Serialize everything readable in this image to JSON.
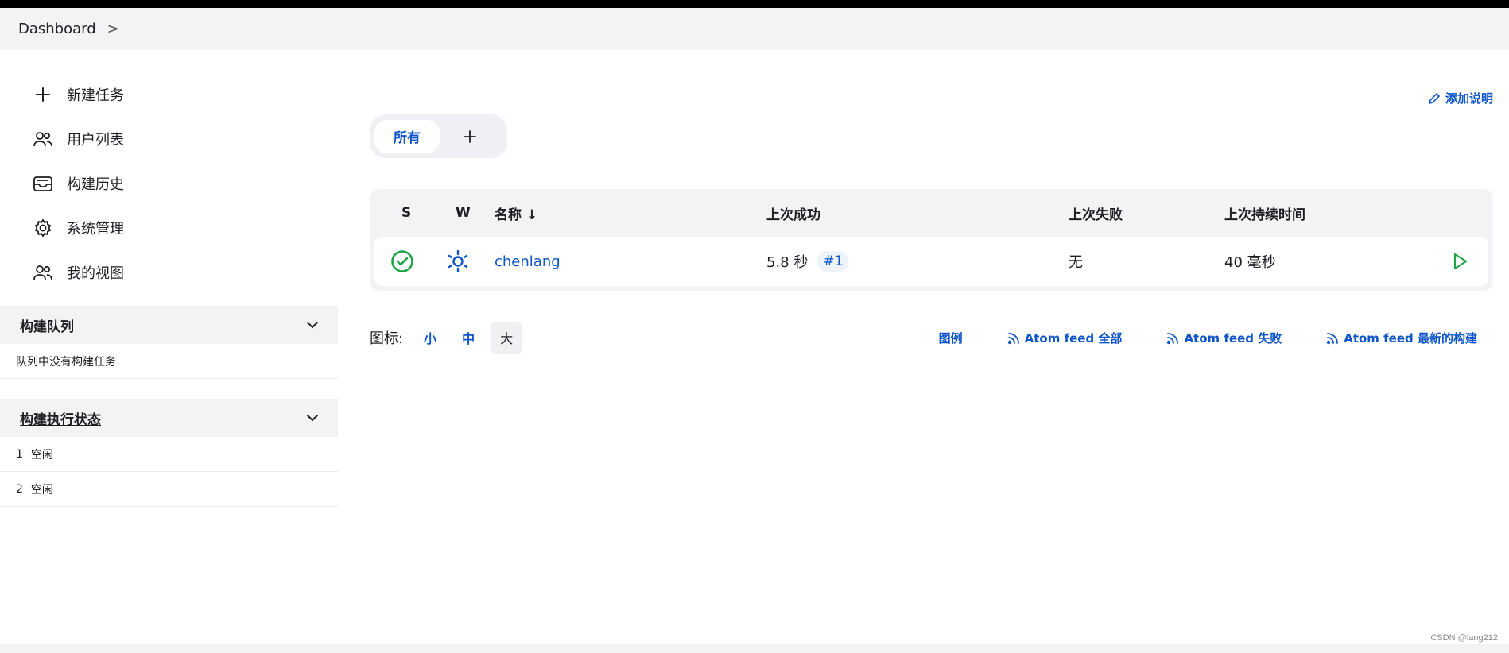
{
  "breadcrumb": {
    "root": "Dashboard",
    "sep": ">"
  },
  "sidebar": {
    "tasks": [
      {
        "label": "新建任务",
        "icon": "plus-icon"
      },
      {
        "label": "用户列表",
        "icon": "users-icon"
      },
      {
        "label": "构建历史",
        "icon": "history-icon"
      },
      {
        "label": "系统管理",
        "icon": "gear-icon"
      },
      {
        "label": "我的视图",
        "icon": "users-icon"
      }
    ],
    "queue": {
      "title": "构建队列",
      "empty_text": "队列中没有构建任务"
    },
    "executors": {
      "title": "构建执行状态",
      "rows": [
        {
          "num": "1",
          "status": "空闲"
        },
        {
          "num": "2",
          "status": "空闲"
        }
      ]
    }
  },
  "main": {
    "add_description": "添加说明",
    "tabs": {
      "all": "所有",
      "add": "+"
    },
    "table": {
      "headers": {
        "s": "S",
        "w": "W",
        "name": "名称 ↓",
        "last_success": "上次成功",
        "last_failure": "上次失败",
        "last_duration": "上次持续时间"
      },
      "rows": [
        {
          "name": "chenlang",
          "last_success": "5.8 秒",
          "build": "#1",
          "last_failure": "无",
          "last_duration": "40 毫秒"
        }
      ]
    },
    "icon_size": {
      "label": "图标:",
      "small": "小",
      "medium": "中",
      "large": "大"
    },
    "feeds": {
      "legend": "图例",
      "all": "Atom feed 全部",
      "failed": "Atom feed 失败",
      "latest": "Atom feed 最新的构建"
    }
  },
  "watermark": "CSDN @lang212",
  "colors": {
    "accent": "#0d55c8",
    "success": "#1ea446",
    "panel": "#f3f3f6"
  }
}
